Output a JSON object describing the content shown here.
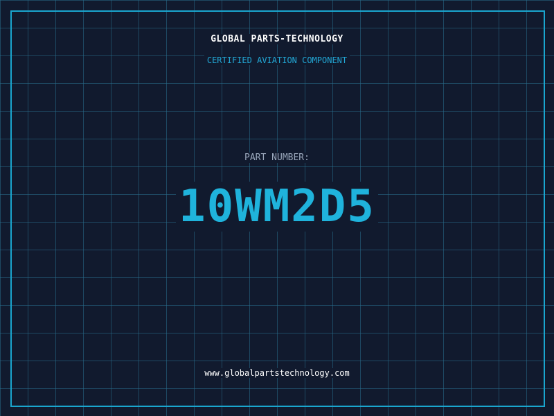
{
  "header": {
    "company": "GLOBAL PARTS-TECHNOLOGY",
    "subtitle": "CERTIFIED AVIATION COMPONENT"
  },
  "main": {
    "part_label": "PART NUMBER:",
    "part_number": "10WM2D5"
  },
  "footer": {
    "url": "www.globalpartstechnology.com"
  },
  "colors": {
    "background": "#111a2e",
    "grid": "#286e8c",
    "accent": "#1fb3dc",
    "frame": "#1aa6cf"
  }
}
